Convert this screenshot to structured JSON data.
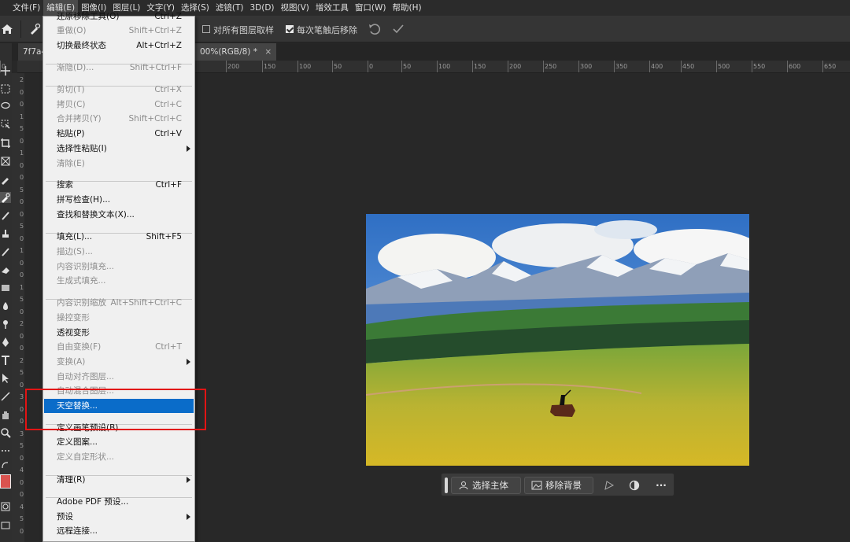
{
  "menubar": {
    "items": [
      "文件(F)",
      "编辑(E)",
      "图像(I)",
      "图层(L)",
      "文字(Y)",
      "选择(S)",
      "滤镜(T)",
      "3D(D)",
      "视图(V)",
      "增效工具",
      "窗口(W)",
      "帮助(H)"
    ],
    "active_index": 1
  },
  "options_bar": {
    "sample_all_layers": {
      "label": "对所有图层取样",
      "checked": false
    },
    "remove_after_stroke": {
      "label": "每次笔触后移除",
      "checked": true
    }
  },
  "document_tabs": {
    "left_tab": "7f7a4",
    "active_tab": "00%(RGB/8) *",
    "close": "×"
  },
  "ruler": {
    "horizontal": [
      "0",
      "50",
      "200",
      "150",
      "100",
      "50",
      "0",
      "50",
      "100",
      "150",
      "200",
      "250",
      "300",
      "350",
      "400",
      "450",
      "500",
      "550",
      "600",
      "650"
    ],
    "vertical": [
      "2",
      "0",
      "0",
      "1",
      "5",
      "0",
      "1",
      "0",
      "0",
      "5",
      "0",
      "0",
      "5",
      "0",
      "1",
      "0",
      "0",
      "1",
      "5",
      "0",
      "2",
      "0",
      "0",
      "2",
      "5",
      "0",
      "3",
      "0",
      "0",
      "3",
      "5",
      "0",
      "4",
      "0",
      "0",
      "4",
      "5",
      "0"
    ]
  },
  "edit_menu": {
    "items": [
      {
        "label": "还原移除工具(O)",
        "shortcut": "Ctrl+Z",
        "disabled": false
      },
      {
        "label": "重做(O)",
        "shortcut": "Shift+Ctrl+Z",
        "disabled": true
      },
      {
        "label": "切换最终状态",
        "shortcut": "Alt+Ctrl+Z",
        "disabled": false
      },
      {
        "label": "渐隐(D)...",
        "shortcut": "Shift+Ctrl+F",
        "disabled": true
      },
      {
        "label": "剪切(T)",
        "shortcut": "Ctrl+X",
        "disabled": true
      },
      {
        "label": "拷贝(C)",
        "shortcut": "Ctrl+C",
        "disabled": true
      },
      {
        "label": "合并拷贝(Y)",
        "shortcut": "Shift+Ctrl+C",
        "disabled": true
      },
      {
        "label": "粘贴(P)",
        "shortcut": "Ctrl+V",
        "disabled": false
      },
      {
        "label": "选择性粘贴(I)",
        "shortcut": "",
        "disabled": false,
        "submenu": true
      },
      {
        "label": "清除(E)",
        "shortcut": "",
        "disabled": true
      },
      {
        "label": "搜索",
        "shortcut": "Ctrl+F",
        "disabled": false
      },
      {
        "label": "拼写检查(H)...",
        "shortcut": "",
        "disabled": false
      },
      {
        "label": "查找和替换文本(X)...",
        "shortcut": "",
        "disabled": false
      },
      {
        "label": "填充(L)...",
        "shortcut": "Shift+F5",
        "disabled": false
      },
      {
        "label": "描边(S)...",
        "shortcut": "",
        "disabled": true
      },
      {
        "label": "内容识别填充...",
        "shortcut": "",
        "disabled": true
      },
      {
        "label": "生成式填充...",
        "shortcut": "",
        "disabled": true
      },
      {
        "label": "内容识别缩放",
        "shortcut": "Alt+Shift+Ctrl+C",
        "disabled": true
      },
      {
        "label": "操控变形",
        "shortcut": "",
        "disabled": true
      },
      {
        "label": "透视变形",
        "shortcut": "",
        "disabled": false
      },
      {
        "label": "自由变换(F)",
        "shortcut": "Ctrl+T",
        "disabled": true
      },
      {
        "label": "变换(A)",
        "shortcut": "",
        "disabled": true,
        "submenu": true
      },
      {
        "label": "自动对齐图层...",
        "shortcut": "",
        "disabled": true
      },
      {
        "label": "自动混合图层...",
        "shortcut": "",
        "disabled": true
      },
      {
        "label": "天空替换...",
        "shortcut": "",
        "disabled": false,
        "selected": true
      },
      {
        "label": "定义画笔预设(B)...",
        "shortcut": "",
        "disabled": false
      },
      {
        "label": "定义图案...",
        "shortcut": "",
        "disabled": false
      },
      {
        "label": "定义自定形状...",
        "shortcut": "",
        "disabled": true
      },
      {
        "label": "清理(R)",
        "shortcut": "",
        "disabled": false,
        "submenu": true
      },
      {
        "label": "Adobe PDF 预设...",
        "shortcut": "",
        "disabled": false
      },
      {
        "label": "预设",
        "shortcut": "",
        "disabled": false,
        "submenu": true
      },
      {
        "label": "远程连接...",
        "shortcut": "",
        "disabled": false
      }
    ]
  },
  "taskbar": {
    "select_subject": "选择主体",
    "remove_background": "移除背景",
    "more": "···"
  },
  "colors": {
    "menu_highlight": "#0a6cc9",
    "annotation_box": "#e21414",
    "foreground_swatch": "#d9534f"
  }
}
